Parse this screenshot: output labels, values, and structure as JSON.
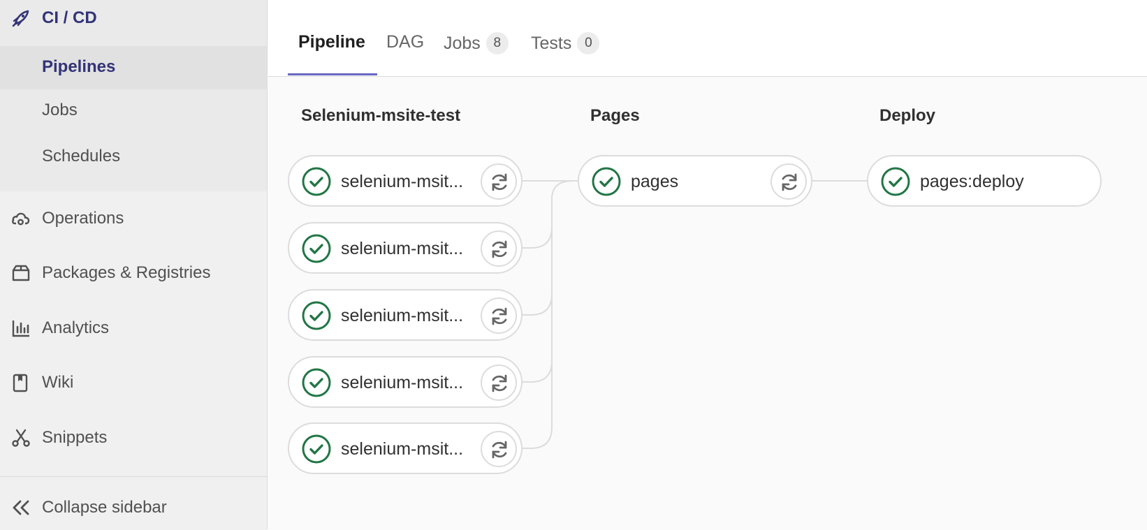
{
  "sidebar": {
    "section_title": "CI / CD",
    "section_icon": "rocket-icon",
    "sub_items": [
      "Pipelines",
      "Jobs",
      "Schedules"
    ],
    "items": [
      {
        "label": "Operations",
        "icon": "cloud-gear-icon"
      },
      {
        "label": "Packages & Registries",
        "icon": "package-icon"
      },
      {
        "label": "Analytics",
        "icon": "chart-icon"
      },
      {
        "label": "Wiki",
        "icon": "book-icon"
      },
      {
        "label": "Snippets",
        "icon": "scissors-icon"
      }
    ],
    "collapse_label": "Collapse sidebar"
  },
  "tabs": [
    {
      "label": "Pipeline",
      "active": true
    },
    {
      "label": "DAG"
    },
    {
      "label": "Jobs",
      "count": "8"
    },
    {
      "label": "Tests",
      "count": "0"
    }
  ],
  "stages": [
    {
      "title": "Selenium-msite-test",
      "jobs": [
        {
          "name": "selenium-msit...",
          "status": "success",
          "action": "retry-icon"
        },
        {
          "name": "selenium-msit...",
          "status": "success",
          "action": "retry-icon"
        },
        {
          "name": "selenium-msit...",
          "status": "success",
          "action": "retry-icon"
        },
        {
          "name": "selenium-msit...",
          "status": "success",
          "action": "retry-icon"
        },
        {
          "name": "selenium-msit...",
          "status": "success",
          "action": "retry-icon"
        }
      ]
    },
    {
      "title": "Pages",
      "jobs": [
        {
          "name": "pages",
          "status": "success",
          "action": "retry-icon"
        }
      ]
    },
    {
      "title": "Deploy",
      "jobs": [
        {
          "name": "pages:deploy",
          "status": "success"
        }
      ]
    }
  ],
  "colors": {
    "accent": "#333378",
    "success": "#217645",
    "tab_underline": "#6666c4"
  }
}
